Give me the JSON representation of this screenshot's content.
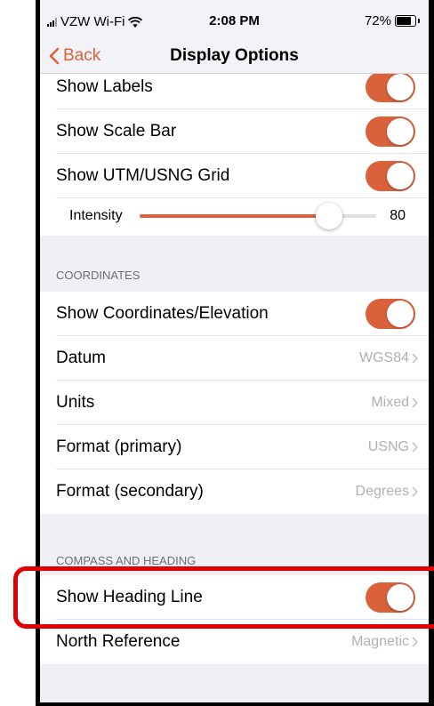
{
  "status": {
    "carrier": "VZW Wi-Fi",
    "time": "2:08 PM",
    "battery": "72%",
    "battery_level": 0.72
  },
  "nav": {
    "back": "Back",
    "title": "Display Options"
  },
  "display": {
    "show_labels": "Show Labels",
    "show_scale_bar": "Show Scale Bar",
    "show_grid": "Show UTM/USNG Grid",
    "intensity_label": "Intensity",
    "intensity_value": "80",
    "intensity_fraction": 0.8
  },
  "coordinates": {
    "header": "COORDINATES",
    "show_coords": "Show Coordinates/Elevation",
    "datum_label": "Datum",
    "datum_value": "WGS84",
    "units_label": "Units",
    "units_value": "Mixed",
    "format_primary_label": "Format (primary)",
    "format_primary_value": "USNG",
    "format_secondary_label": "Format (secondary)",
    "format_secondary_value": "Degrees"
  },
  "compass": {
    "header": "COMPASS AND HEADING",
    "show_heading": "Show Heading Line",
    "north_ref_label": "North Reference",
    "north_ref_value": "Magnetic"
  },
  "colors": {
    "accent": "#d9623b",
    "highlight": "#e00000"
  }
}
